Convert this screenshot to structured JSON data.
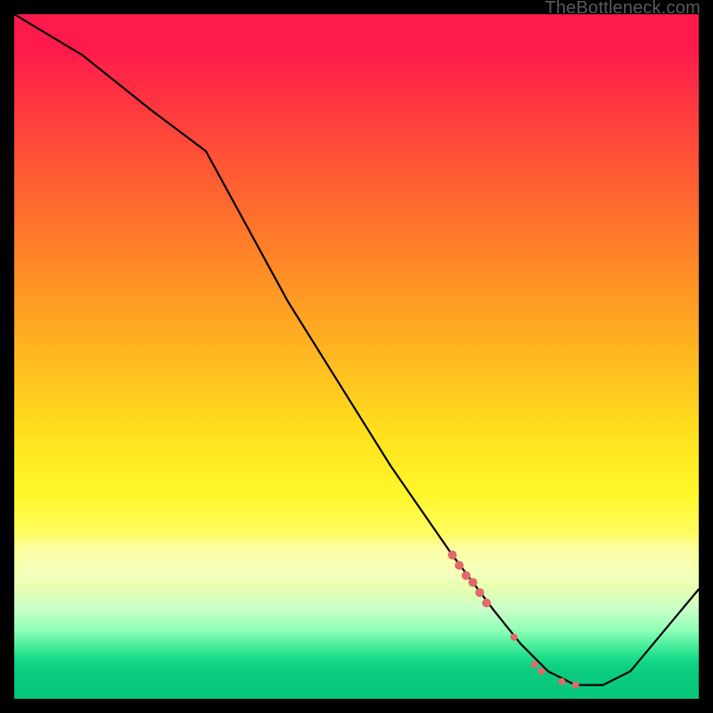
{
  "attribution": "TheBottleneck.com",
  "colors": {
    "line": "#000000",
    "marker": "#e06a6a",
    "frame": "#000000"
  },
  "chart_data": {
    "type": "line",
    "title": "",
    "xlabel": "",
    "ylabel": "",
    "xlim": [
      0,
      100
    ],
    "ylim": [
      0,
      100
    ],
    "grid": false,
    "series": [
      {
        "name": "curve",
        "x": [
          0,
          5,
          10,
          20,
          28,
          40,
          55,
          64,
          70,
          74,
          78,
          82,
          86,
          90,
          100
        ],
        "y": [
          100,
          97,
          94,
          86,
          80,
          58,
          34,
          21,
          13,
          8,
          4,
          2,
          2,
          4,
          16
        ]
      }
    ],
    "markers": [
      {
        "name": "highlight-cluster",
        "shape": "circle",
        "color": "#e06a6a",
        "points": [
          {
            "x": 64.0,
            "y": 21.0,
            "r": 5
          },
          {
            "x": 65.0,
            "y": 19.5,
            "r": 5
          },
          {
            "x": 66.0,
            "y": 18.0,
            "r": 5
          },
          {
            "x": 67.0,
            "y": 17.0,
            "r": 5
          },
          {
            "x": 68.0,
            "y": 15.5,
            "r": 5
          },
          {
            "x": 69.0,
            "y": 14.0,
            "r": 5
          },
          {
            "x": 73.0,
            "y": 9.0,
            "r": 4
          },
          {
            "x": 76.0,
            "y": 5.0,
            "r": 4
          },
          {
            "x": 77.0,
            "y": 4.0,
            "r": 4
          },
          {
            "x": 80.0,
            "y": 2.5,
            "r": 4
          },
          {
            "x": 82.0,
            "y": 2.0,
            "r": 4
          }
        ]
      }
    ],
    "annotations": []
  }
}
